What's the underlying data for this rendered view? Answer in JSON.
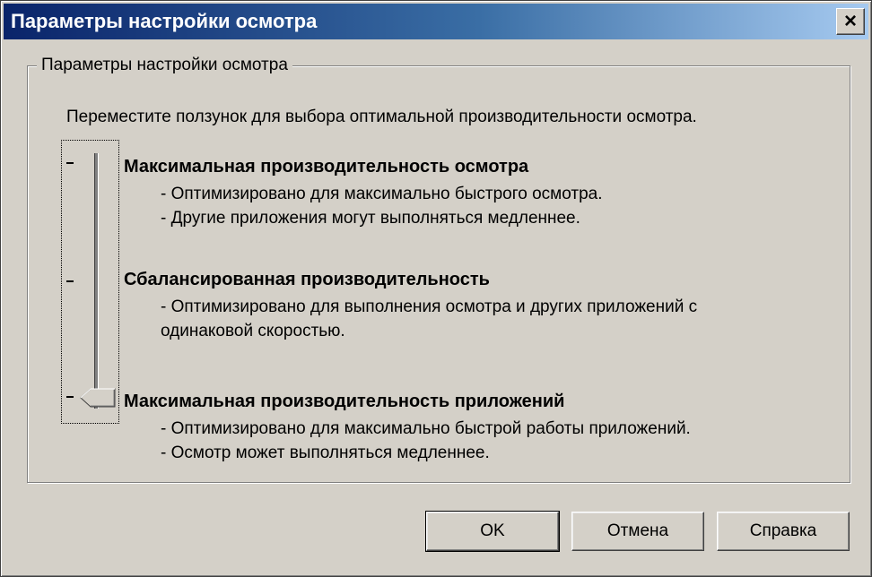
{
  "window": {
    "title": "Параметры настройки осмотра",
    "close_label": "×"
  },
  "group": {
    "legend": "Параметры настройки осмотра",
    "instruction": "Переместите ползунок для выбора оптимальной производительности осмотра."
  },
  "slider": {
    "selected_index": 2,
    "positions": 3
  },
  "options": [
    {
      "title": "Максимальная производительность осмотра",
      "lines": [
        "- Оптимизировано для максимально быстрого осмотра.",
        "- Другие приложения могут выполняться медленнее."
      ]
    },
    {
      "title": "Сбалансированная производительность",
      "lines": [
        "- Оптимизировано для выполнения осмотра и других приложений с",
        "одинаковой скоростью."
      ]
    },
    {
      "title": "Максимальная производительность приложений",
      "lines": [
        "- Оптимизировано для максимально быстрой работы приложений.",
        "- Осмотр может выполняться медленнее."
      ]
    }
  ],
  "buttons": {
    "ok": "OK",
    "cancel": "Отмена",
    "help": "Справка"
  }
}
